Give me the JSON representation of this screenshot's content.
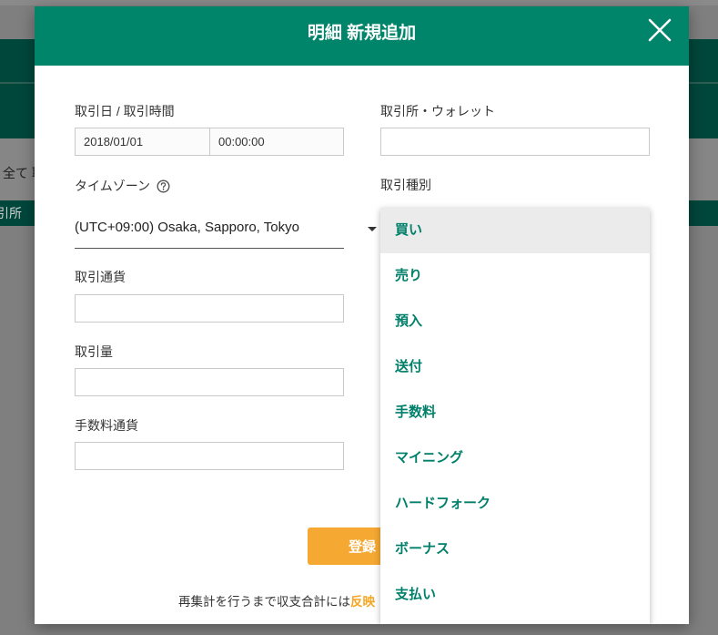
{
  "background": {
    "filter_text": "全て 取",
    "exchange_header": "引所"
  },
  "modal": {
    "title": "明細 新規追加",
    "fields": {
      "trade_datetime_label": "取引日 / 取引時間",
      "trade_date_value": "2018/01/01",
      "trade_time_value": "00:00:00",
      "timezone_label": "タイムゾーン",
      "timezone_value": "(UTC+09:00) Osaka, Sapporo, Tokyo",
      "currency_label": "取引通貨",
      "amount_label": "取引量",
      "fee_currency_label": "手数料通貨",
      "exchange_label": "取引所・ウォレット",
      "trade_type_label": "取引種別"
    },
    "trade_type_options": [
      "買い",
      "売り",
      "預入",
      "送付",
      "手数料",
      "マイニング",
      "ハードフォーク",
      "ボーナス",
      "支払い"
    ],
    "selected_option": "買い",
    "submit_label": "登録",
    "note_text": "再集計を行うまで収支合計には",
    "note_link": "反映"
  },
  "icons": {
    "close": "close-icon",
    "help": "question-circle-icon",
    "caret": "caret-down-icon"
  },
  "colors": {
    "header": "#00846a",
    "option_text": "#00806a",
    "selected_option_bg": "#ebebeb",
    "submit_button": "#f5a832",
    "note_link": "#f5a623",
    "page_dark_green": "#00473b"
  }
}
